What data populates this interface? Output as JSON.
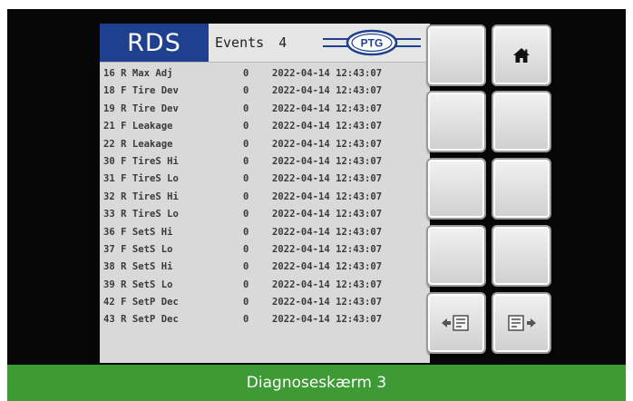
{
  "header": {
    "title": "RDS",
    "events_label": "Events",
    "events_count": "4",
    "logo_text": "PTG"
  },
  "rows": [
    {
      "id": "16 R Max Adj",
      "value": "0",
      "timestamp": "2022-04-14 12:43:07"
    },
    {
      "id": "18 F Tire Dev",
      "value": "0",
      "timestamp": "2022-04-14 12:43:07"
    },
    {
      "id": "19 R Tire Dev",
      "value": "0",
      "timestamp": "2022-04-14 12:43:07"
    },
    {
      "id": "21 F Leakage",
      "value": "0",
      "timestamp": "2022-04-14 12:43:07"
    },
    {
      "id": "22 R Leakage",
      "value": "0",
      "timestamp": "2022-04-14 12:43:07"
    },
    {
      "id": "30 F TireS Hi",
      "value": "0",
      "timestamp": "2022-04-14 12:43:07"
    },
    {
      "id": "31 F TireS Lo",
      "value": "0",
      "timestamp": "2022-04-14 12:43:07"
    },
    {
      "id": "32 R TireS Hi",
      "value": "0",
      "timestamp": "2022-04-14 12:43:07"
    },
    {
      "id": "33 R TireS Lo",
      "value": "0",
      "timestamp": "2022-04-14 12:43:07"
    },
    {
      "id": "36 F SetS Hi",
      "value": "0",
      "timestamp": "2022-04-14 12:43:07"
    },
    {
      "id": "37 F SetS Lo",
      "value": "0",
      "timestamp": "2022-04-14 12:43:07"
    },
    {
      "id": "38 R SetS Hi",
      "value": "0",
      "timestamp": "2022-04-14 12:43:07"
    },
    {
      "id": "39 R SetS Lo",
      "value": "0",
      "timestamp": "2022-04-14 12:43:07"
    },
    {
      "id": "42 F SetP Dec",
      "value": "0",
      "timestamp": "2022-04-14 12:43:07"
    },
    {
      "id": "43 R SetP Dec",
      "value": "0",
      "timestamp": "2022-04-14 12:43:07"
    }
  ],
  "buttons": {
    "home_icon": "home-icon",
    "prev_icon": "arrow-left-screen-icon",
    "next_icon": "arrow-right-screen-icon"
  },
  "caption": "Diagnoseskærm 3",
  "colors": {
    "header_blue": "#1f3f8f",
    "caption_green": "#3e9a35",
    "frame": "#070707",
    "screen": "#d9d9d9"
  }
}
